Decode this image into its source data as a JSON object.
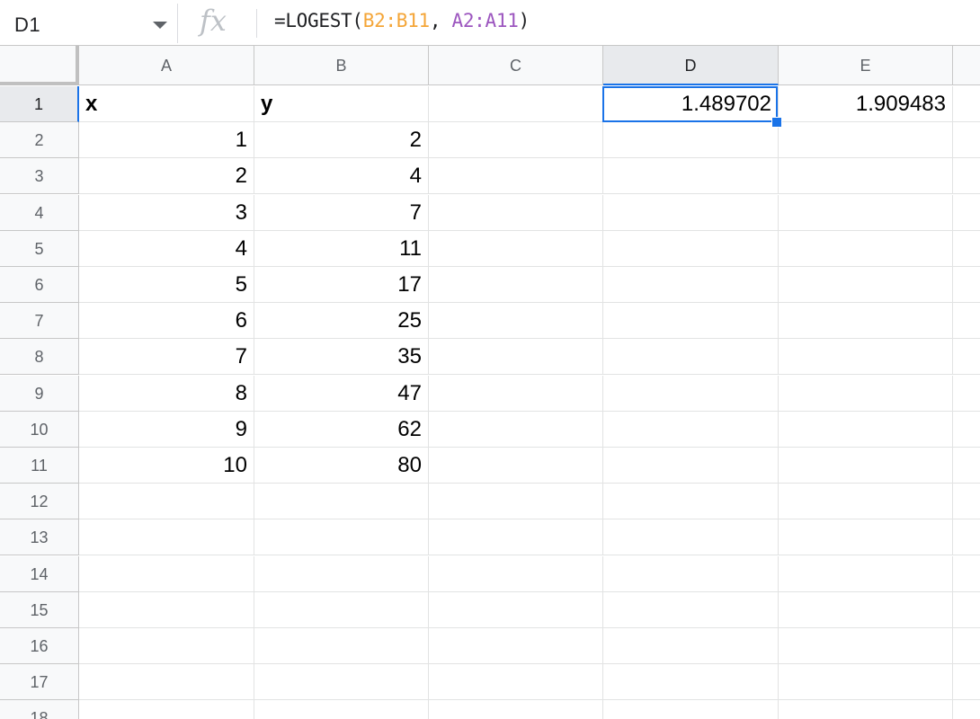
{
  "formula_bar": {
    "name_box": "D1",
    "fx_label": "fx",
    "formula_prefix": "=LOGEST(",
    "formula_ref1": "B2:B11",
    "formula_sep": ", ",
    "formula_ref2": "A2:A11",
    "formula_suffix": ")"
  },
  "colors": {
    "selection": "#1a73e8",
    "ref1": "#f4a537",
    "ref2": "#9c56bf"
  },
  "grid": {
    "columns": [
      "A",
      "B",
      "C",
      "D",
      "E"
    ],
    "rows": [
      "1",
      "2",
      "3",
      "4",
      "5",
      "6",
      "7",
      "8",
      "9",
      "10",
      "11",
      "12",
      "13",
      "14",
      "15",
      "16",
      "17",
      "18"
    ],
    "cells": {
      "A1": "x",
      "B1": "y",
      "D1": "1.489702",
      "E1": "1.909483",
      "A2": "1",
      "B2": "2",
      "A3": "2",
      "B3": "4",
      "A4": "3",
      "B4": "7",
      "A5": "4",
      "B5": "11",
      "A6": "5",
      "B6": "17",
      "A7": "6",
      "B7": "25",
      "A8": "7",
      "B8": "35",
      "A9": "8",
      "B9": "47",
      "A10": "9",
      "B10": "62",
      "A11": "10",
      "B11": "80"
    },
    "selected_cell": "D1"
  }
}
